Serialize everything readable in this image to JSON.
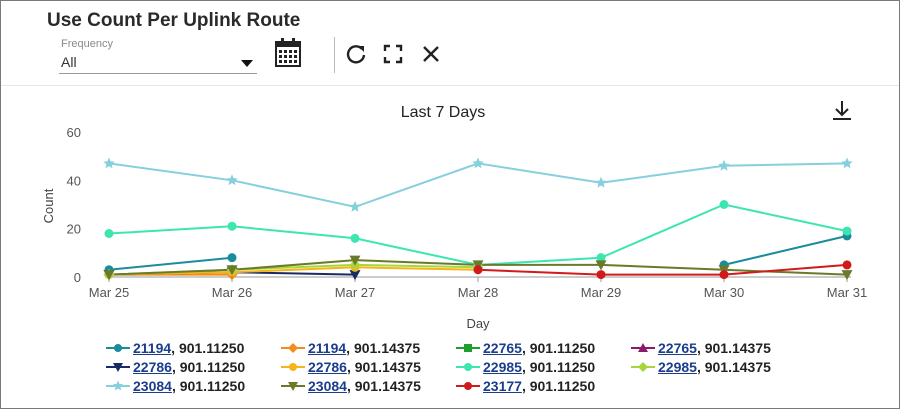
{
  "header": {
    "title": "Use Count Per Uplink Route"
  },
  "frequency": {
    "label": "Frequency",
    "value": "All"
  },
  "icons": {
    "calendar": "calendar-icon",
    "refresh": "refresh-icon",
    "fullscreen": "fullscreen-icon",
    "close": "close-icon",
    "download": "download-icon"
  },
  "chart_data": {
    "type": "line",
    "title": "Last 7 Days",
    "xlabel": "Day",
    "ylabel": "Count",
    "categories": [
      "Mar 25",
      "Mar 26",
      "Mar 27",
      "Mar 28",
      "Mar 29",
      "Mar 30",
      "Mar 31"
    ],
    "yticks": [
      0,
      20,
      40,
      60
    ],
    "ylim": [
      0,
      60
    ],
    "grid": false,
    "legend_position": "bottom",
    "series": [
      {
        "name": "21194, 901.11250",
        "id": "21194",
        "freq": ", 901.11250",
        "color": "#1a8c9c",
        "marker": "circle",
        "values": [
          3,
          8,
          null,
          null,
          null,
          5,
          17
        ]
      },
      {
        "name": "21194, 901.14375",
        "id": "21194",
        "freq": ", 901.14375",
        "color": "#f28c1c",
        "marker": "diamond",
        "values": [
          1,
          1,
          null,
          null,
          null,
          null,
          null
        ]
      },
      {
        "name": "22765, 901.11250",
        "id": "22765",
        "freq": ", 901.11250",
        "color": "#1f9e30",
        "marker": "square",
        "values": [
          null,
          null,
          null,
          null,
          null,
          null,
          null
        ]
      },
      {
        "name": "22765, 901.14375",
        "id": "22765",
        "freq": ", 901.14375",
        "color": "#8c1a6b",
        "marker": "triangle-up",
        "values": [
          null,
          null,
          null,
          null,
          null,
          null,
          null
        ]
      },
      {
        "name": "22786, 901.11250",
        "id": "22786",
        "freq": ", 901.11250",
        "color": "#1a2a66",
        "marker": "triangle-down",
        "values": [
          1,
          2,
          1,
          null,
          null,
          null,
          null
        ]
      },
      {
        "name": "22786, 901.14375",
        "id": "22786",
        "freq": ", 901.14375",
        "color": "#f5b51a",
        "marker": "circle",
        "values": [
          1,
          2,
          4,
          3,
          null,
          null,
          null
        ]
      },
      {
        "name": "22985, 901.11250",
        "id": "22985",
        "freq": ", 901.11250",
        "color": "#3ce6b0",
        "marker": "circle",
        "values": [
          18,
          21,
          16,
          5,
          8,
          30,
          19
        ]
      },
      {
        "name": "22985, 901.14375",
        "id": "22985",
        "freq": ", 901.14375",
        "color": "#a8d63a",
        "marker": "diamond",
        "values": [
          1,
          3,
          5,
          4,
          null,
          null,
          null
        ]
      },
      {
        "name": "23084, 901.11250",
        "id": "23084",
        "freq": ", 901.11250",
        "color": "#86cfdc",
        "marker": "star",
        "values": [
          47,
          40,
          29,
          47,
          39,
          46,
          47
        ]
      },
      {
        "name": "23084, 901.14375",
        "id": "23084",
        "freq": ", 901.14375",
        "color": "#6b7a2a",
        "marker": "triangle-down",
        "values": [
          1,
          3,
          7,
          5,
          5,
          3,
          1
        ]
      },
      {
        "name": "23177, 901.11250",
        "id": "23177",
        "freq": ", 901.11250",
        "color": "#d11a1a",
        "marker": "circle",
        "values": [
          null,
          null,
          null,
          3,
          1,
          1,
          5
        ]
      }
    ]
  }
}
